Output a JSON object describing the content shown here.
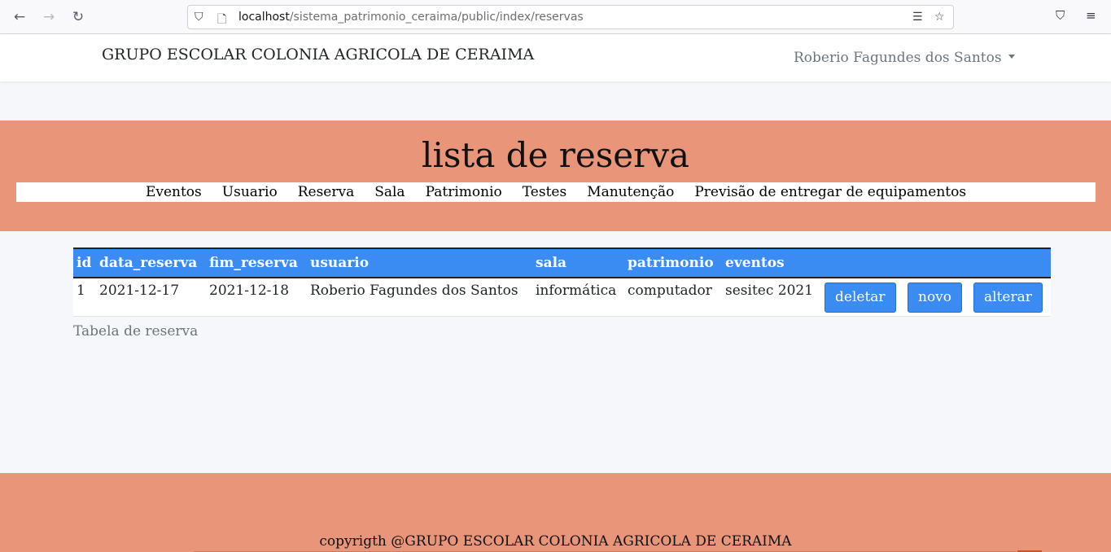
{
  "browser": {
    "url_host": "localhost",
    "url_path": "/sistema_patrimonio_ceraima/public/index/reservas"
  },
  "header": {
    "brand": "GRUPO ESCOLAR COLONIA AGRICOLA DE CERAIMA",
    "user_name": "Roberio Fagundes dos Santos"
  },
  "hero": {
    "title": "lista de reserva",
    "menu": [
      "Eventos",
      "Usuario",
      "Reserva",
      "Sala",
      "Patrimonio",
      "Testes",
      "Manutenção",
      "Previsão de entregar de equipamentos"
    ]
  },
  "table": {
    "columns": [
      "id",
      "data_reserva",
      "fim_reserva",
      "usuario",
      "sala",
      "patrimonio",
      "eventos"
    ],
    "rows": [
      [
        "1",
        "2021-12-17",
        "2021-12-18",
        "Roberio Fagundes dos Santos",
        "informática",
        "computador",
        "sesitec 2021"
      ]
    ],
    "actions": [
      "deletar",
      "novo",
      "alterar"
    ],
    "caption": "Tabela de reserva"
  },
  "footer": {
    "text": "copyrigth @GRUPO ESCOLAR COLONIA AGRICOLA DE CERAIMA"
  },
  "colors": {
    "accent_salmon": "#e9957a",
    "table_header_blue": "#3b8cf2"
  }
}
